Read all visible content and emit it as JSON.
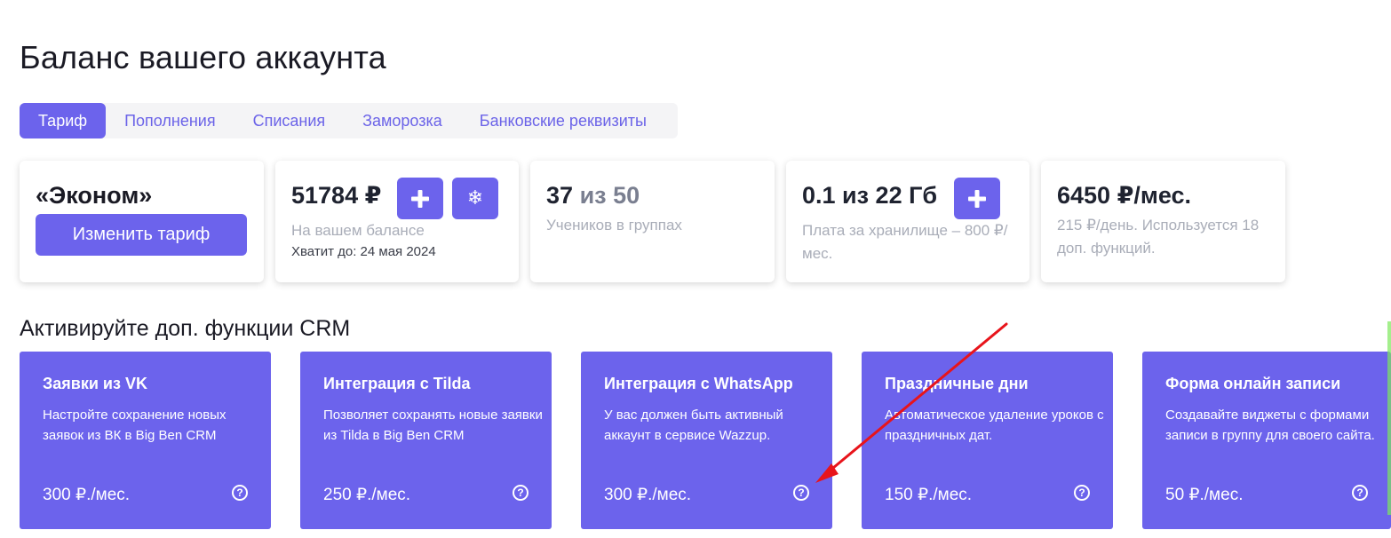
{
  "page": {
    "title": "Баланс вашего аккаунта"
  },
  "tabs": [
    {
      "label": "Тариф",
      "active": true
    },
    {
      "label": "Пополнения",
      "active": false
    },
    {
      "label": "Списания",
      "active": false
    },
    {
      "label": "Заморозка",
      "active": false
    },
    {
      "label": "Банковские реквизиты",
      "active": false
    }
  ],
  "cards": {
    "plan": {
      "name": "«Эконом»",
      "change_label": "Изменить тариф"
    },
    "balance": {
      "value": "51784 ₽",
      "caption": "На вашем балансе",
      "until": "Хватит до: 24 мая 2024",
      "add_icon": "plus-icon",
      "freeze_icon": "snowflake-icon"
    },
    "students": {
      "current": "37",
      "of": "из",
      "max": "50",
      "caption": "Учеников в группах"
    },
    "storage": {
      "value": "0.1 из 22 Гб",
      "caption": "Плата за хранилище – 800 ₽/мес.",
      "add_icon": "plus-icon"
    },
    "monthly": {
      "value": "6450 ₽/мес.",
      "caption": "215 ₽/день. Используется 18 доп. функций."
    }
  },
  "features_section": {
    "title": "Активируйте доп. функции CRM"
  },
  "features": [
    {
      "title": "Заявки из VK",
      "desc": "Настройте сохранение новых заявок из ВК в Big Ben CRM",
      "price": "300 ₽./мес."
    },
    {
      "title": "Интеграция с Tilda",
      "desc": "Позволяет сохранять новые заявки из Tilda в Big Ben CRM",
      "price": "250 ₽./мес."
    },
    {
      "title": "Интеграция с WhatsApp",
      "desc": "У вас должен быть активный аккаунт в сервисе Wazzup.",
      "price": "300 ₽./мес."
    },
    {
      "title": "Праздничные дни",
      "desc": "Автоматическое удаление уроков с праздничных дат.",
      "price": "150 ₽./мес."
    },
    {
      "title": "Форма онлайн записи",
      "desc": "Создавайте виджеты с формами записи в группу для своего сайта.",
      "price": "50 ₽./мес."
    }
  ],
  "colors": {
    "accent": "#6c63ec",
    "annotation_arrow": "#e8141b"
  }
}
